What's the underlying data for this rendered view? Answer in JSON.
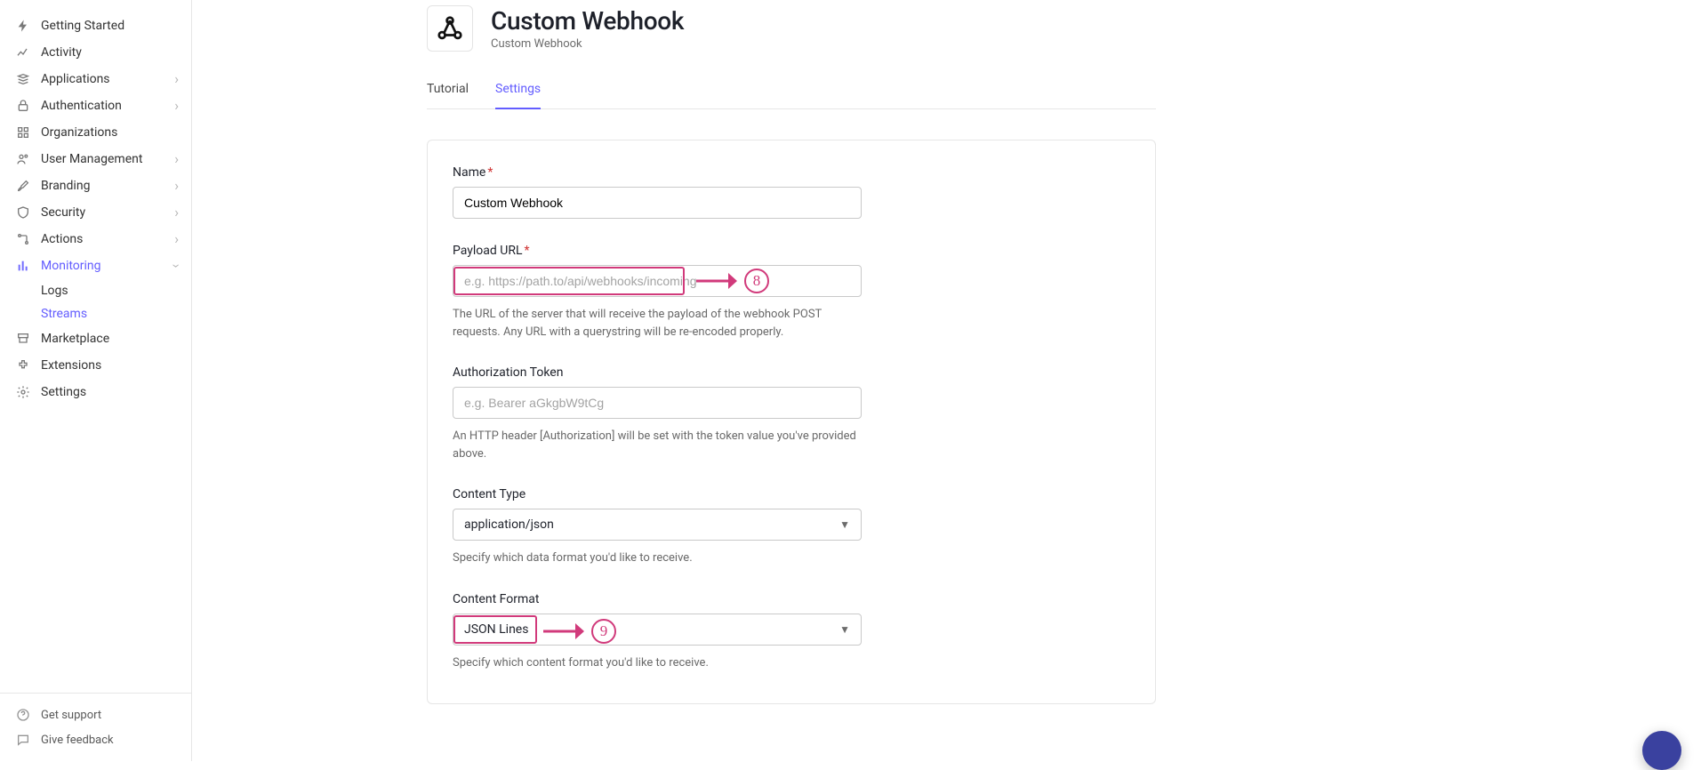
{
  "sidebar": {
    "items": [
      {
        "icon": "bolt",
        "label": "Getting Started",
        "expandable": false
      },
      {
        "icon": "chart",
        "label": "Activity",
        "expandable": false
      },
      {
        "icon": "stack",
        "label": "Applications",
        "expandable": true
      },
      {
        "icon": "lock",
        "label": "Authentication",
        "expandable": true
      },
      {
        "icon": "grid",
        "label": "Organizations",
        "expandable": false
      },
      {
        "icon": "users",
        "label": "User Management",
        "expandable": true
      },
      {
        "icon": "brush",
        "label": "Branding",
        "expandable": true
      },
      {
        "icon": "shield",
        "label": "Security",
        "expandable": true
      },
      {
        "icon": "flow",
        "label": "Actions",
        "expandable": true
      },
      {
        "icon": "bars",
        "label": "Monitoring",
        "expandable": true,
        "active": true,
        "children": [
          {
            "label": "Logs",
            "active": false
          },
          {
            "label": "Streams",
            "active": true
          }
        ]
      },
      {
        "icon": "cart",
        "label": "Marketplace",
        "expandable": false
      },
      {
        "icon": "puzzle",
        "label": "Extensions",
        "expandable": false
      },
      {
        "icon": "gear",
        "label": "Settings",
        "expandable": false
      }
    ],
    "bottom": [
      {
        "icon": "help",
        "label": "Get support"
      },
      {
        "icon": "chat",
        "label": "Give feedback"
      }
    ]
  },
  "header": {
    "title": "Custom Webhook",
    "subtitle": "Custom Webhook"
  },
  "tabs": [
    {
      "label": "Tutorial",
      "active": false
    },
    {
      "label": "Settings",
      "active": true
    }
  ],
  "form": {
    "name": {
      "label": "Name",
      "value": "Custom Webhook",
      "required": true
    },
    "payload_url": {
      "label": "Payload URL",
      "value": "",
      "placeholder": "e.g. https://path.to/api/webhooks/incoming",
      "required": true,
      "help": "The URL of the server that will receive the payload of the webhook POST requests. Any URL with a querystring will be re-encoded properly."
    },
    "auth_token": {
      "label": "Authorization Token",
      "value": "",
      "placeholder": "e.g. Bearer aGkgbW9tCg",
      "help": "An HTTP header [Authorization] will be set with the token value you've provided above."
    },
    "content_type": {
      "label": "Content Type",
      "value": "application/json",
      "help": "Specify which data format you'd like to receive."
    },
    "content_format": {
      "label": "Content Format",
      "value": "JSON Lines",
      "help": "Specify which content format you'd like to receive."
    }
  },
  "annotations": {
    "steps": {
      "8": "8",
      "9": "9"
    }
  }
}
